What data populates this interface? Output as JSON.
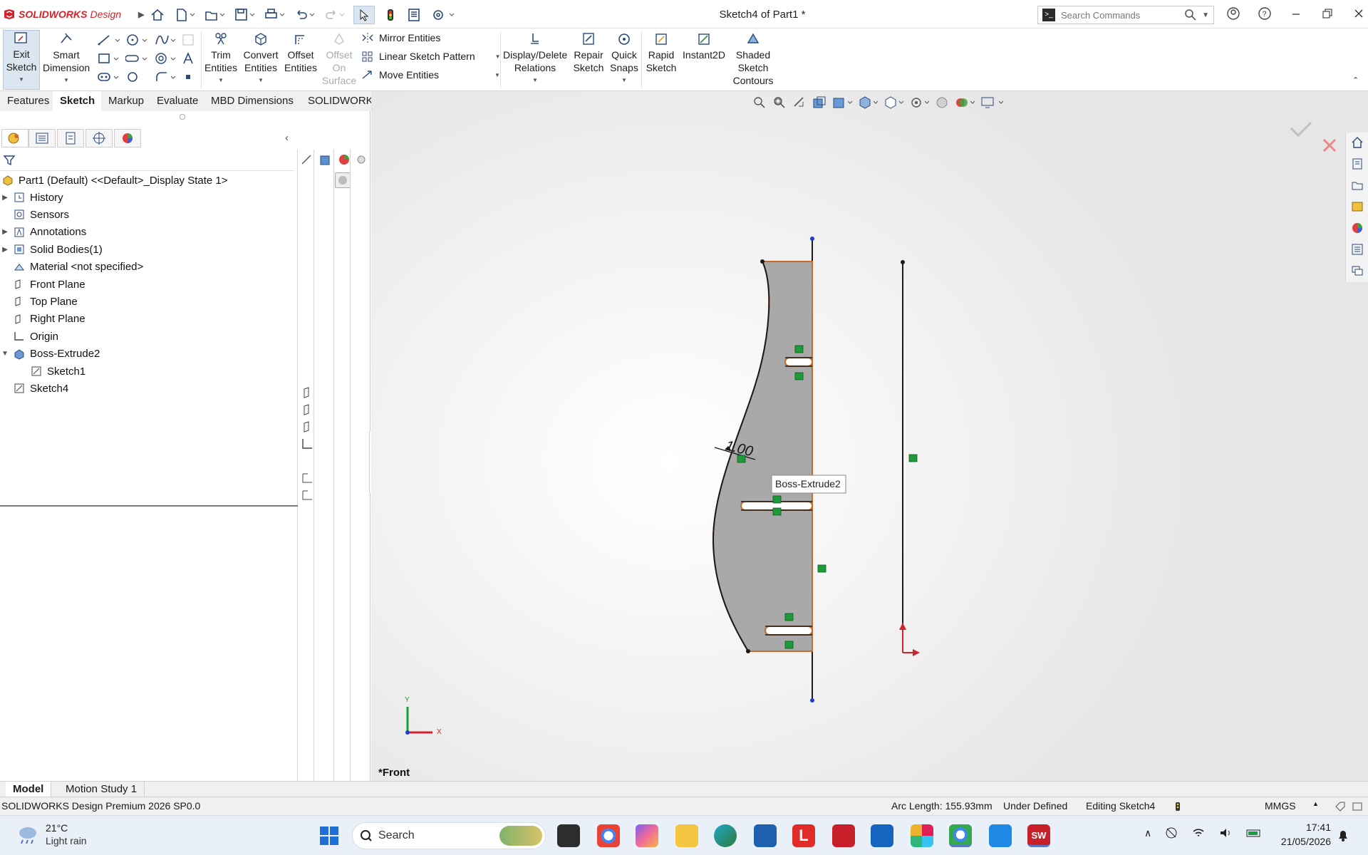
{
  "app": {
    "brand_a": "SOLIDWORKS",
    "brand_b": "Design",
    "doc_title": "Sketch4 of Part1 *"
  },
  "search": {
    "placeholder": "Search Commands"
  },
  "ribbon": {
    "exit_sketch": [
      "Exit",
      "Sketch"
    ],
    "smart_dimension": [
      "Smart",
      "Dimension"
    ],
    "trim": [
      "Trim",
      "Entities"
    ],
    "convert": [
      "Convert",
      "Entities"
    ],
    "offset": [
      "Offset",
      "Entities"
    ],
    "offset_surface": [
      "Offset",
      "On",
      "Surface"
    ],
    "mirror": "Mirror Entities",
    "linear_pattern": "Linear Sketch Pattern",
    "move": "Move Entities",
    "display_delete": [
      "Display/Delete",
      "Relations"
    ],
    "repair": [
      "Repair",
      "Sketch"
    ],
    "quick_snaps": [
      "Quick",
      "Snaps"
    ],
    "rapid_sketch": [
      "Rapid",
      "Sketch"
    ],
    "instant2d": "Instant2D",
    "shaded": [
      "Shaded",
      "Sketch",
      "Contours"
    ]
  },
  "tabs": [
    "Features",
    "Sketch",
    "Markup",
    "Evaluate",
    "MBD Dimensions",
    "SOLIDWORKS Add-Ins"
  ],
  "active_tab": "Sketch",
  "tree": {
    "root": "Part1 (Default) <<Default>_Display State 1>",
    "items": [
      {
        "label": "History",
        "expandable": true,
        "icon": "history-icon"
      },
      {
        "label": "Sensors",
        "expandable": false,
        "icon": "sensor-icon"
      },
      {
        "label": "Annotations",
        "expandable": true,
        "icon": "annotation-icon"
      },
      {
        "label": "Solid Bodies(1)",
        "expandable": true,
        "icon": "solid-bodies-icon"
      },
      {
        "label": "Material <not specified>",
        "expandable": false,
        "icon": "material-icon"
      },
      {
        "label": "Front Plane",
        "expandable": false,
        "icon": "plane-icon"
      },
      {
        "label": "Top Plane",
        "expandable": false,
        "icon": "plane-icon"
      },
      {
        "label": "Right Plane",
        "expandable": false,
        "icon": "plane-icon"
      },
      {
        "label": "Origin",
        "expandable": false,
        "icon": "origin-icon"
      },
      {
        "label": "Boss-Extrude2",
        "expandable": true,
        "expanded": true,
        "icon": "extrude-icon"
      },
      {
        "label": "Sketch1",
        "expandable": false,
        "icon": "sketch-icon",
        "child": true
      },
      {
        "label": "Sketch4",
        "expandable": false,
        "icon": "sketch-icon"
      }
    ]
  },
  "viewport": {
    "tooltip": "Boss-Extrude2",
    "dimension": "1.00",
    "view_name": "*Front",
    "axis_x": "X",
    "axis_y": "Y"
  },
  "bottom_tabs": [
    "Model",
    "Motion Study 1"
  ],
  "status": {
    "product": "SOLIDWORKS Design Premium 2026 SP0.0",
    "arc_length": "Arc Length: 155.93mm",
    "defined": "Under Defined",
    "editing": "Editing Sketch4",
    "units": "MMGS"
  },
  "taskbar": {
    "temp": "21°C",
    "weather": "Light rain",
    "search": "Search",
    "time": "17:41",
    "date": "21/05/2026"
  },
  "colors": {
    "accent": "#d2232a",
    "sketch_line": "#1a1a1a",
    "face": "#a9a9a9",
    "edge": "#c86a2a",
    "relation": "#1f9a3a"
  }
}
